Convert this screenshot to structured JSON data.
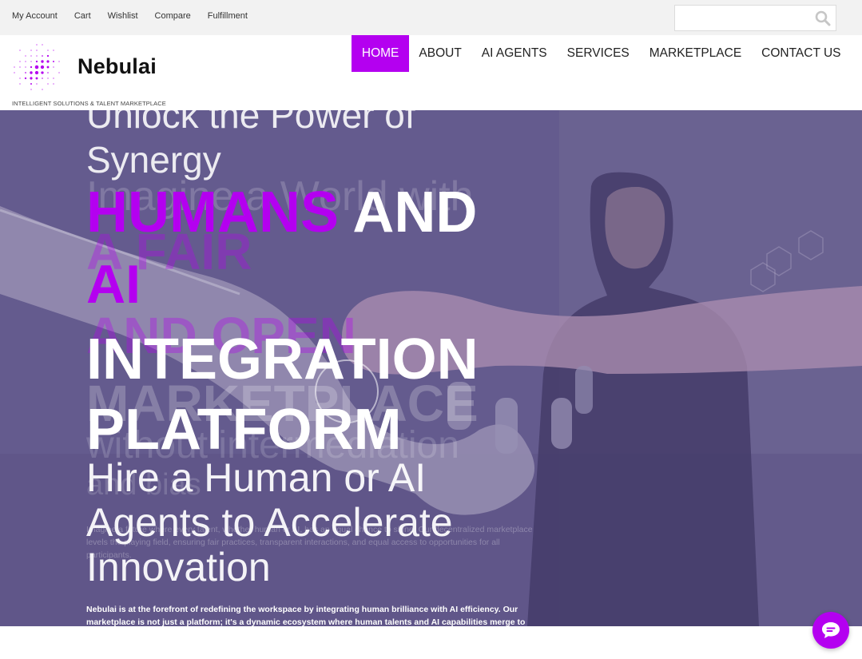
{
  "topbar": {
    "links": [
      "My Account",
      "Cart",
      "Wishlist",
      "Compare",
      "Fulfillment"
    ],
    "search_placeholder": ""
  },
  "header": {
    "brand": "Nebulai",
    "tagline": "INTELLIGENT SOLUTIONS & TALENT MARKETPLACE",
    "nav": [
      "HOME",
      "ABOUT",
      "AI AGENTS",
      "SERVICES",
      "MARKETPLACE",
      "CONTACT US"
    ],
    "active_nav": "HOME"
  },
  "hero": {
    "unlock_line1": "Unlock the Power of",
    "unlock_line2": "Synergy",
    "ghost_imagine": "Imagine a World with",
    "ghost_fair": "A FAIR",
    "ghost_open": "AND OPEN",
    "ghost_marketplace": "MARKETPLACE",
    "ghost_without": "without intermediation",
    "ghost_bias": "and bias",
    "humans": "HUMANS",
    "and": "AND",
    "ai": "AI",
    "integration": "INTEGRATION",
    "platform": "PLATFORM",
    "hire": "Hire a Human or AI Agents to Accelerate Innovation",
    "faint_paragraph": "Imagine a future where every talent, whether human or AI, has an equal chance to shine. Our decentralized marketplace levels the playing field, ensuring fair practices, transparent interactions, and equal access to opportunities for all participants.",
    "main_paragraph": "Nebulai is at the forefront of redefining the workspace by integrating human brilliance with AI efficiency. Our marketplace is not just a platform; it's a dynamic ecosystem where human talents and AI capabilities merge to push"
  },
  "colors": {
    "accent": "#b400f0",
    "topbar_bg": "#f2f2f2",
    "hero_overlay": "#5a4a8c"
  },
  "icons": {
    "search": "search-icon",
    "chat": "chat-bubble-icon",
    "logo": "dotted-nebula-logo"
  }
}
